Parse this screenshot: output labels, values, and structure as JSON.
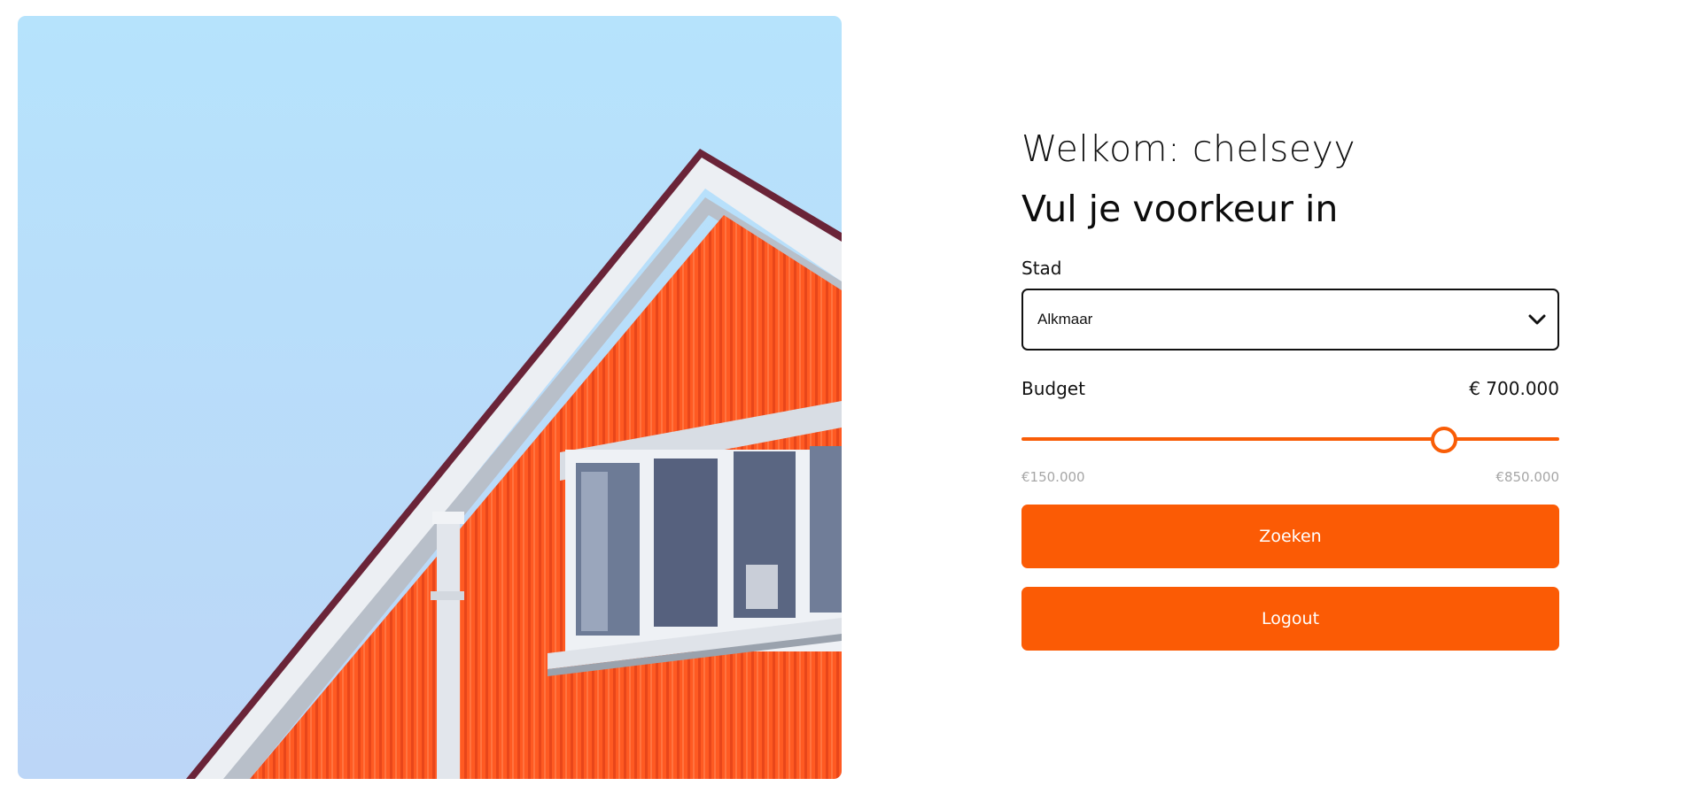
{
  "welcome": {
    "prefix": "Welkom: ",
    "username": "chelseyy"
  },
  "heading": "Vul je voorkeur in",
  "city": {
    "label": "Stad",
    "selected": "Alkmaar",
    "icon": "chevron-down-icon"
  },
  "budget": {
    "label": "Budget",
    "display_value": "€ 700.000",
    "value": 700000,
    "min": 150000,
    "max": 850000,
    "min_label": "€150.000",
    "max_label": "€850.000"
  },
  "buttons": {
    "search_label": "Zoeken",
    "logout_label": "Logout"
  },
  "colors": {
    "accent": "#fb5b05",
    "sky": "#b7e2fb",
    "facade": "#ff5a1f"
  }
}
